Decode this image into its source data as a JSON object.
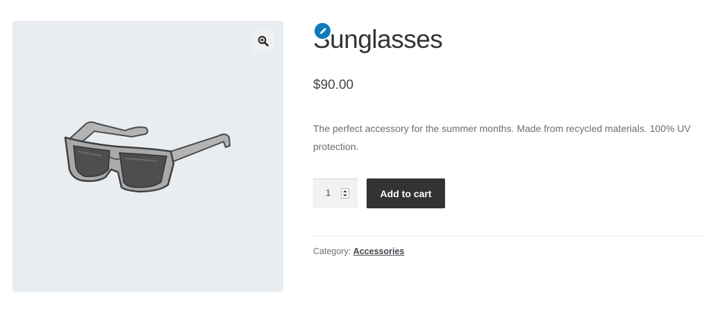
{
  "product": {
    "title": "Sunglasses",
    "price": "$90.00",
    "description": "The perfect accessory for the summer months. Made from recycled materials. 100% UV protection.",
    "quantity": "1",
    "add_to_cart_label": "Add to cart",
    "category_label": "Category:",
    "category_link": "Accessories"
  },
  "icons": {
    "zoom": "magnifier-plus-icon",
    "edit": "pencil-icon"
  },
  "colors": {
    "button": "#333333",
    "edit_badge": "#0e7bb8",
    "gallery_bg": "#e8edf2"
  }
}
